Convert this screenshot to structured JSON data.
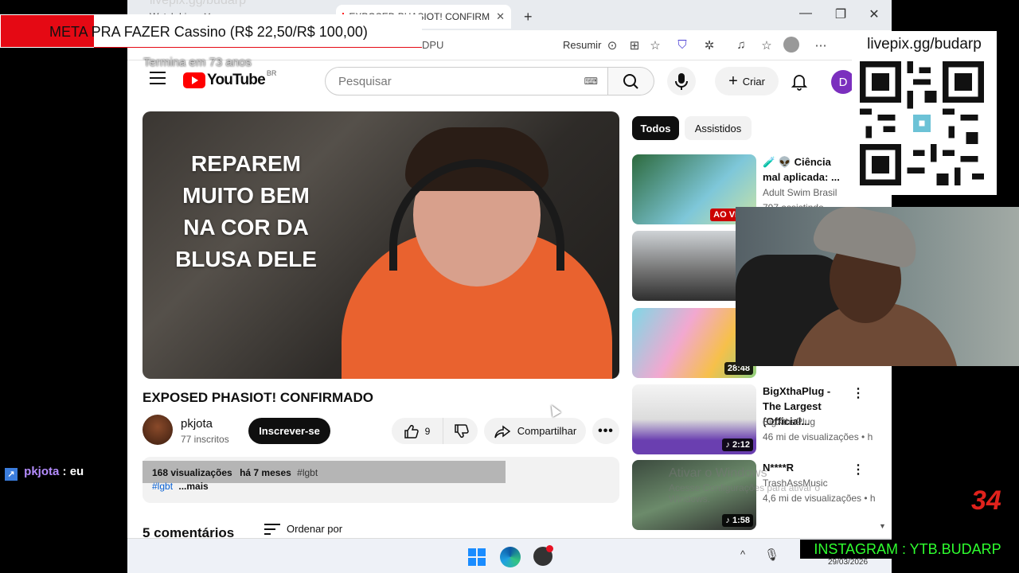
{
  "browser": {
    "tabs": [
      {
        "label": "Watch Live",
        "active": false
      },
      {
        "label": "EXPOSED PHASIOT! CONFIRM",
        "active": true
      }
    ],
    "new_tab": "+",
    "address_fragment": "DPU",
    "summarize_label": "Resumir",
    "window_controls": [
      "—",
      "❐",
      "✕"
    ]
  },
  "youtube": {
    "logo_text": "YouTube",
    "country_code": "BR",
    "search_placeholder": "Pesquisar",
    "create_label": "Criar",
    "avatar_letter": "D"
  },
  "video": {
    "overlay_lines": [
      "REPAREM",
      "MUITO BEM",
      "NA COR DA",
      "BLUSA DELE"
    ],
    "title": "EXPOSED PHASIOT! CONFIRMADO",
    "channel_name": "pkjota",
    "subscribers": "77 inscritos",
    "subscribe_label": "Inscrever-se",
    "likes": "9",
    "share_label": "Compartilhar",
    "more_label": "•••",
    "views": "168 visualizações",
    "age": "há 7 meses",
    "tag_inline": "#lgbt",
    "tag_link": "#lgbt",
    "more_text": "...mais",
    "comments_count": "5 comentários",
    "sort_label": "Ordenar por"
  },
  "chips": {
    "all": "Todos",
    "watched": "Assistidos"
  },
  "recommendations": [
    {
      "title": "🧪 👽 Ciência mal aplicada: ...",
      "channel": "Adult Swim Brasil",
      "views": "797 assistindo",
      "badge": "AO VIVO",
      "live": true
    },
    {
      "title": "",
      "channel": "",
      "views": "",
      "badge": "♪",
      "live": false
    },
    {
      "title": "",
      "channel": "",
      "views": "",
      "badge": "28:48",
      "live": false
    },
    {
      "title": "BigXthaPlug - The Largest (Official...",
      "channel": "BigXthaPlug",
      "views": "46 mi de visualizações • h",
      "badge": "♪ 2:12",
      "live": false
    },
    {
      "title": "N****R",
      "channel": "TrashAssMusic",
      "views": "4,6 mi de visualizações • h",
      "badge": "♪ 1:58",
      "live": false
    }
  ],
  "watermark": {
    "line1": "Ativar o Windows",
    "line2": "Acesse Configurações para ativar o Windows."
  },
  "taskbar": {
    "date": "29/03/2026",
    "tray_up": "^"
  },
  "overlay": {
    "goal_text": "META PRA FAZER Cassino (R$ 22,50/R$ 100,00)",
    "goal_sub": "Termina em 73 anos",
    "ghost_url": "livepix.gg/budarp",
    "qr_url": "livepix.gg/budarp",
    "chat_user": "pkjota",
    "chat_msg": ": eu",
    "counter": "34",
    "instagram": "INSTAGRAM : YTB.BUDARP"
  },
  "colors": {
    "youtube_red": "#ff0000",
    "goal_red": "#e50914",
    "instagram_green": "#2fff2f",
    "counter_red": "#e0221c",
    "chat_purple": "#b58dff"
  }
}
